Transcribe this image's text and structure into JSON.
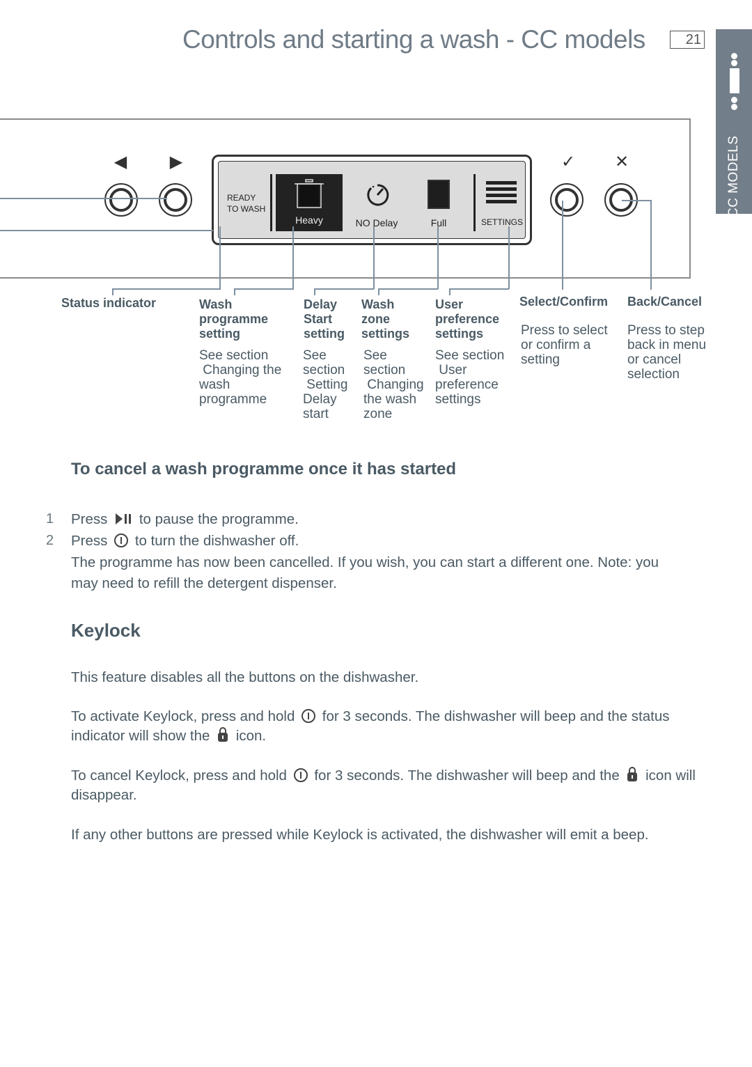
{
  "header": {
    "title": "Controls and starting a wash - CC models",
    "page_number": "21",
    "side_tab": "CC MODELS"
  },
  "panel": {
    "left_buttons": [
      {
        "glyph": "◀",
        "icon": "left-arrow-icon"
      },
      {
        "glyph": "▶",
        "icon": "right-arrow-icon"
      }
    ],
    "right_buttons": [
      {
        "glyph": "✓",
        "icon": "check-icon"
      },
      {
        "glyph": "✕",
        "icon": "close-icon"
      }
    ],
    "display": {
      "status_line1": "READY",
      "status_line2": "TO WASH",
      "programme": "Heavy",
      "delay": "NO Delay",
      "zone": "Full",
      "settings": "SETTINGS"
    }
  },
  "callouts": [
    {
      "title": "Status indicator",
      "body": ""
    },
    {
      "title": "Wash\nprogramme\nsetting",
      "body": "See section\n Changing the\nwash\nprogramme"
    },
    {
      "title": "Delay\nStart\nsetting",
      "body": "See\nsection\n Setting\nDelay\nstart"
    },
    {
      "title": "Wash\nzone\nsettings",
      "body": "See\nsection\n Changing\nthe wash\nzone"
    },
    {
      "title": "User\npreference\nsettings",
      "body": "See section\n User\npreference\nsettings"
    },
    {
      "title": "Select/Confirm",
      "body": "Press to select\nor confirm a\nsetting"
    },
    {
      "title": "Back/Cancel",
      "body": "Press to step\nback in menu\nor cancel\nselection"
    }
  ],
  "cancel_section": {
    "heading": "To cancel a wash programme once it has started",
    "steps": [
      {
        "number": "1",
        "before": "Press",
        "after": "to pause the programme.",
        "icon": "play-pause-icon"
      },
      {
        "number": "2",
        "before": "Press",
        "after": "to turn the dishwasher off.",
        "icon": "power-icon"
      }
    ],
    "note_line1": "The programme has now been cancelled. If you wish, you can start a different one. Note: you",
    "note_line2": "may need to refill the detergent dispenser."
  },
  "keylock_section": {
    "heading": "Keylock",
    "intro": "This feature disables all the buttons on the dishwasher.",
    "activate_a": "To activate Keylock, press and hold",
    "activate_b": "for 3 seconds. The dishwasher will beep and the status",
    "activate_c": "indicator will show the",
    "activate_d": "icon.",
    "cancel_a": "To cancel Keylock, press and hold",
    "cancel_b": "for 3 seconds. The dishwasher will beep and the",
    "cancel_c": "icon will",
    "cancel_d": "disappear.",
    "other": "If any other buttons are pressed while Keylock is activated, the dishwasher will emit a beep."
  }
}
